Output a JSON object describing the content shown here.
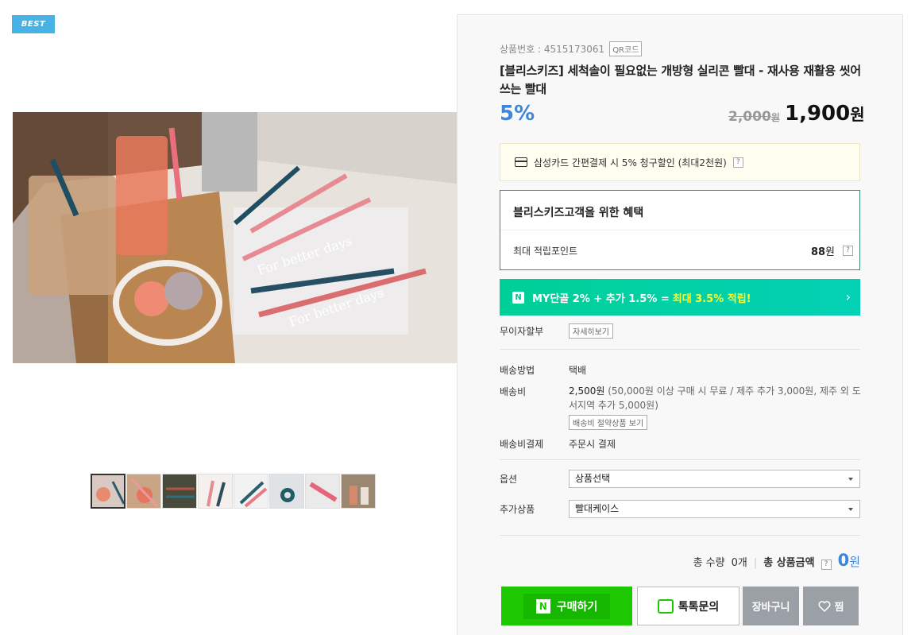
{
  "badge": "BEST",
  "product": {
    "number_label": "상품번호 : 4515173061",
    "qr_label": "QR코드",
    "title": "[블리스키즈] 세척솔이 필요없는 개방형 실리콘 빨대 - 재사용 재활용 씻어쓰는 빨대",
    "discount": "5%",
    "original_price": "2,000",
    "original_unit": "원",
    "sale_price": "1,900",
    "sale_unit": "원"
  },
  "photo_text": [
    "For better days",
    "For better days"
  ],
  "card_promo": {
    "text": "삼성카드 간편결제 시 5% 청구할인 (최대2천원)",
    "help": "?"
  },
  "benefit": {
    "title": "블리스키즈고객을 위한 혜택",
    "label": "최대 적립포인트",
    "value": "88",
    "unit": "원",
    "help": "?"
  },
  "npay": {
    "logo": "N",
    "text": "MY단골 2% + 추가 1.5% =",
    "highlight": "최대 3.5% 적립!",
    "chevron": "›"
  },
  "installment": {
    "label": "무이자할부",
    "button": "자세히보기"
  },
  "shipping": {
    "method_label": "배송방법",
    "method_value": "택배",
    "fee_label": "배송비",
    "fee_amount": "2,500원",
    "fee_detail": " (50,000원 이상 구매 시 무료 / 제주 추가 3,000원, 제주 외 도서지역 추가 5,000원)",
    "fee_button": "배송비 절약상품 보기",
    "payment_label": "배송비결제",
    "payment_value": "주문시 결제"
  },
  "options": {
    "label": "옵션",
    "value": "상품선택"
  },
  "addon": {
    "label": "추가상품",
    "value": "빨대케이스"
  },
  "total": {
    "qty_label": "총 수량",
    "qty_value": "0개",
    "amount_label": "총 상품금액",
    "help": "?",
    "amount": "0",
    "unit": "원"
  },
  "buttons": {
    "buy_logo": "N",
    "buy": "구매하기",
    "talk": "톡톡문의",
    "cart": "장바구니",
    "wish": "찜"
  },
  "colors": {
    "accent_blue": "#3f87d6",
    "npay_green": "#00cf97",
    "buy_green": "#1ec800",
    "benefit_border": "#3e8b7a"
  }
}
